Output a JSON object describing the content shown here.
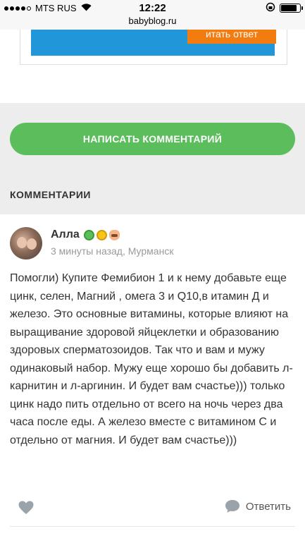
{
  "status_bar": {
    "carrier": "MTS RUS",
    "time": "12:22"
  },
  "url_bar": {
    "domain": "babyblog.ru"
  },
  "ad": {
    "button_label": "итать ответ"
  },
  "actions": {
    "write_comment_label": "НАПИСАТЬ КОММЕНТАРИЙ"
  },
  "comments_section": {
    "title": "КОММЕНТАРИИ"
  },
  "comment": {
    "author": "Алла",
    "meta": "3 минуты назад, Мурманск",
    "text": "Помогли) Купите Фемибион 1 и к нему добавьте еще цинк, селен, Магний , омега 3 и Q10,в итамин Д и железо. Это основные витамины, которые влияют на выращивание здоровой яйцеклетки и образованию здоровых сперматозоидов. Так что и вам и мужу одинаковый набор. Мужу еще хорошо бы добавить л-карнитин и л-аргинин. И будет вам счастье))) только цинк надо пить отдельно от всего на ночь через два часа после еды. А железо вместе с витамином С и отдельно от магния. И будет вам счастье)))",
    "reply_label": "Ответить",
    "badges": [
      "green-circle-icon",
      "gold-circle-icon",
      "baby-icon"
    ]
  },
  "colors": {
    "primary_green": "#5cbd5c",
    "ad_blue": "#2196d8",
    "ad_orange": "#f27c10",
    "band_gray": "#ededed"
  }
}
